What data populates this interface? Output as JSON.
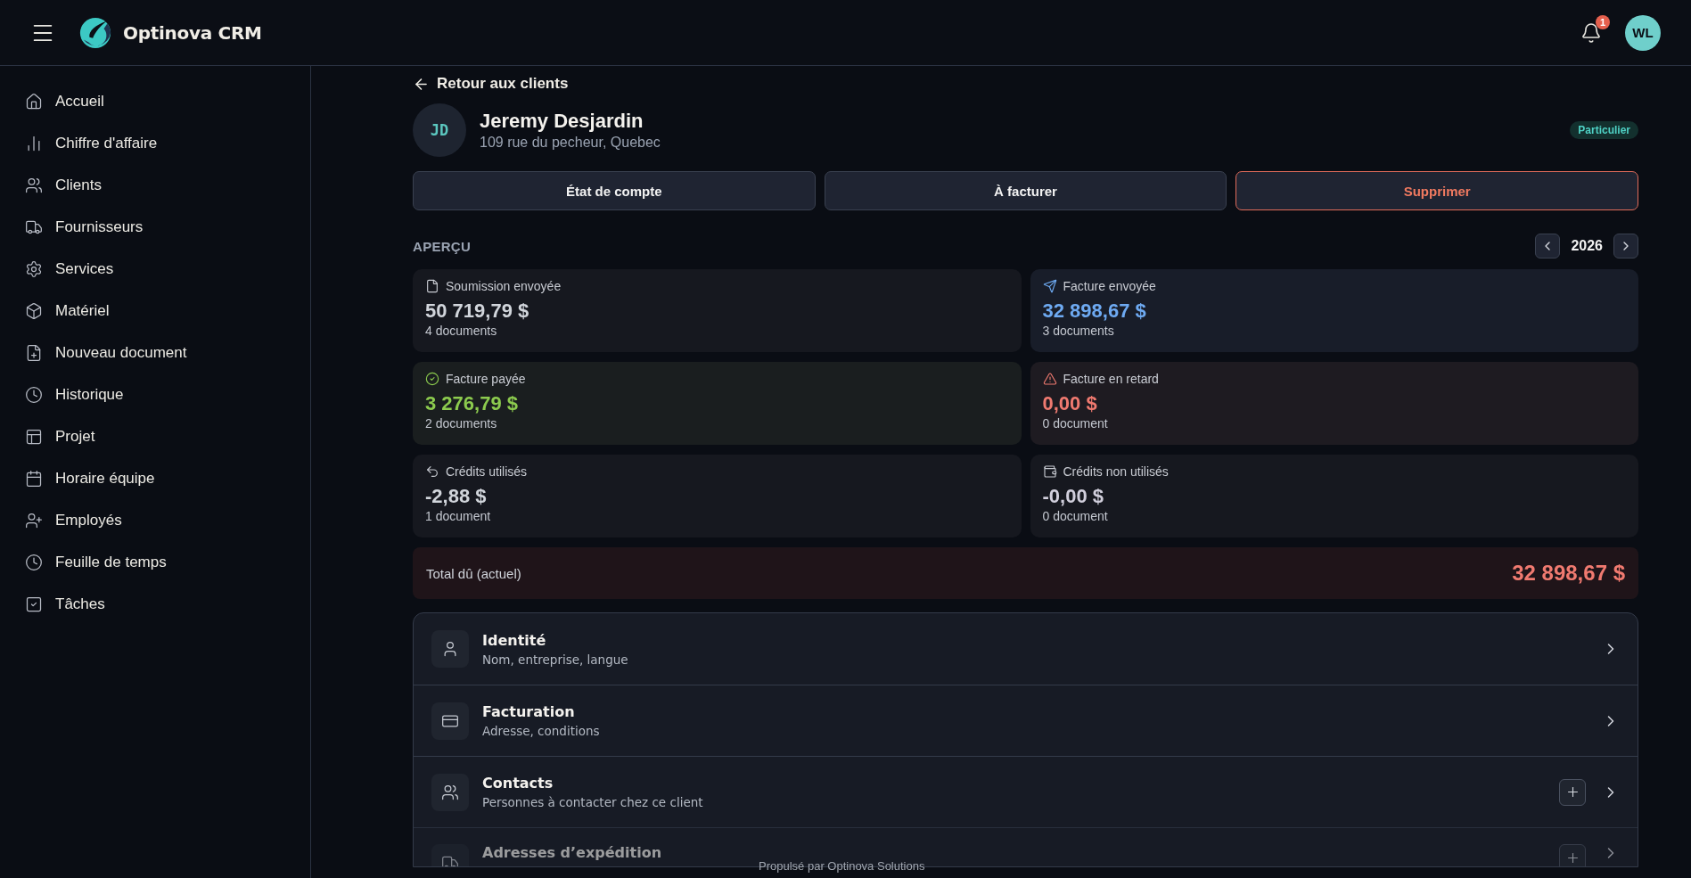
{
  "header": {
    "app_name": "Optinova CRM",
    "notification_count": "1",
    "user_initials": "WL"
  },
  "sidebar": {
    "items": [
      {
        "label": "Accueil"
      },
      {
        "label": "Chiffre d'affaire"
      },
      {
        "label": "Clients"
      },
      {
        "label": "Fournisseurs"
      },
      {
        "label": "Services"
      },
      {
        "label": "Matériel"
      },
      {
        "label": "Nouveau document"
      },
      {
        "label": "Historique"
      },
      {
        "label": "Projet"
      },
      {
        "label": "Horaire équipe"
      },
      {
        "label": "Employés"
      },
      {
        "label": "Feuille de temps"
      },
      {
        "label": "Tâches"
      }
    ]
  },
  "back_link": "Retour aux clients",
  "client": {
    "initials": "JD",
    "name": "Jeremy Desjardin",
    "address": "109 rue du pecheur, Quebec",
    "type_badge": "Particulier"
  },
  "actions": [
    {
      "label": "État de compte",
      "kind": "default"
    },
    {
      "label": "À facturer",
      "kind": "default"
    },
    {
      "label": "Supprimer",
      "kind": "danger"
    }
  ],
  "overview": {
    "title": "APERÇU",
    "year": "2026",
    "cards": [
      {
        "label": "Soumission envoyée",
        "amount": "50 719,79 $",
        "count": "4 documents",
        "color": "#d1d5db"
      },
      {
        "label": "Facture envoyée",
        "amount": "32 898,67 $",
        "count": "3 documents",
        "color": "#6eaaf2"
      },
      {
        "label": "Facture payée",
        "amount": "3 276,79 $",
        "count": "2 documents",
        "color": "#8ccb4e"
      },
      {
        "label": "Facture en retard",
        "amount": "0,00 $",
        "count": "0 document",
        "color": "#f07a70"
      },
      {
        "label": "Crédits utilisés",
        "amount": "-2,88 $",
        "count": "1 document",
        "color": "#d1d5db"
      },
      {
        "label": "Crédits non utilisés",
        "amount": "-0,00 $",
        "count": "0 document",
        "color": "#d1cfdc"
      }
    ],
    "total": {
      "label": "Total dû (actuel)",
      "amount": "32 898,67 $"
    }
  },
  "sections": [
    {
      "title": "Identité",
      "subtitle": "Nom, entreprise, langue",
      "add": false
    },
    {
      "title": "Facturation",
      "subtitle": "Adresse, conditions",
      "add": false
    },
    {
      "title": "Contacts",
      "subtitle": "Personnes à contacter chez ce client",
      "add": true
    },
    {
      "title": "Adresses d’expédition",
      "add": true
    }
  ],
  "footer": "Propulsé par Optinova Solutions"
}
